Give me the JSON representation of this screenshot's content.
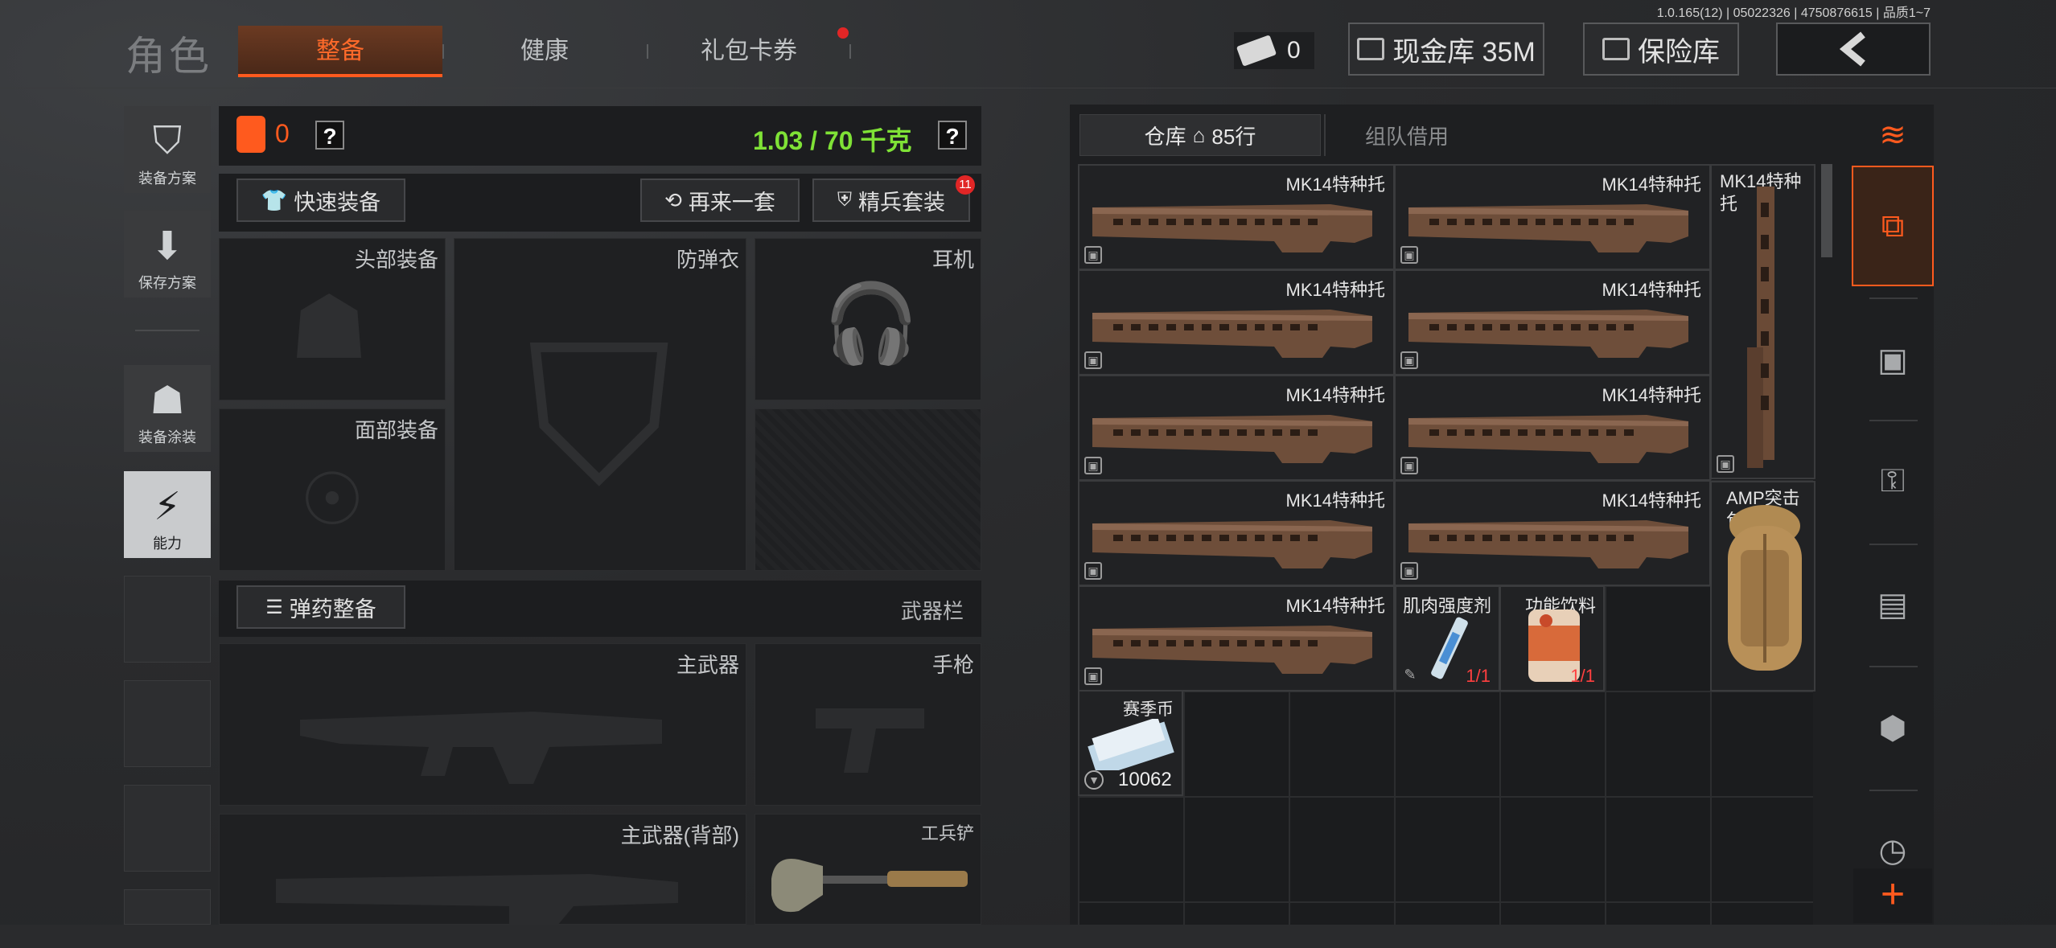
{
  "version": "1.0.165(12) | 05022326 | 4750876615 | 品质1~7",
  "header": {
    "title": "角色",
    "tabs": [
      {
        "label": "整备",
        "active": true
      },
      {
        "label": "健康",
        "active": false
      },
      {
        "label": "礼包卡券",
        "active": false,
        "badge_dot": true
      }
    ],
    "ticket_count": "0",
    "cash_vault_label": "现金库 35M",
    "safe_label": "保险库",
    "back_icon": "chevron-left-icon"
  },
  "sidebar": {
    "items": [
      {
        "label": "装备方案",
        "icon": "vest-icon"
      },
      {
        "label": "保存方案",
        "icon": "download-icon"
      },
      {
        "label": "装备涂装",
        "icon": "helmet-icon"
      },
      {
        "label": "能力",
        "icon": "lightning-icon"
      }
    ]
  },
  "loadout": {
    "armor_count": "0",
    "help": "?",
    "weight": "1.03 / 70 千克",
    "quick_equip": "快速装备",
    "repeat_set": "再来一套",
    "elite_set": "精兵套装",
    "elite_badge": "11",
    "slots": {
      "head": "头部装备",
      "armor": "防弹衣",
      "headset": "耳机",
      "face": "面部装备"
    },
    "ammo_equip": "弹药整备",
    "weapon_bar": "武器栏",
    "weapon_slots": {
      "primary": "主武器",
      "pistol": "手枪",
      "primary_back": "主武器(背部)",
      "shovel": "工兵铲"
    }
  },
  "warehouse": {
    "tab_label": "仓库",
    "rows": "85行",
    "team_borrow": "组队借用",
    "items": {
      "mk14_name": "MK14特种托",
      "mk14_tall_name": "MK14特种托",
      "amp_name": "AMP突击包",
      "muscle_name": "肌肉强度剂",
      "muscle_qty": "1/1",
      "drink_name": "功能饮料",
      "drink_qty": "1/1",
      "coin_name": "赛季币",
      "coin_amount": "10062"
    }
  },
  "right_tabs": [
    "stack-refresh-icon",
    "stack-up-icon",
    "safe-box-icon",
    "key-icon",
    "cash-icon",
    "box-icon",
    "clock-icon"
  ],
  "add_symbol": "+",
  "colors": {
    "accent": "#ff5a1e",
    "weight_green": "#7fe236",
    "qty_red": "#ff3f3f"
  }
}
